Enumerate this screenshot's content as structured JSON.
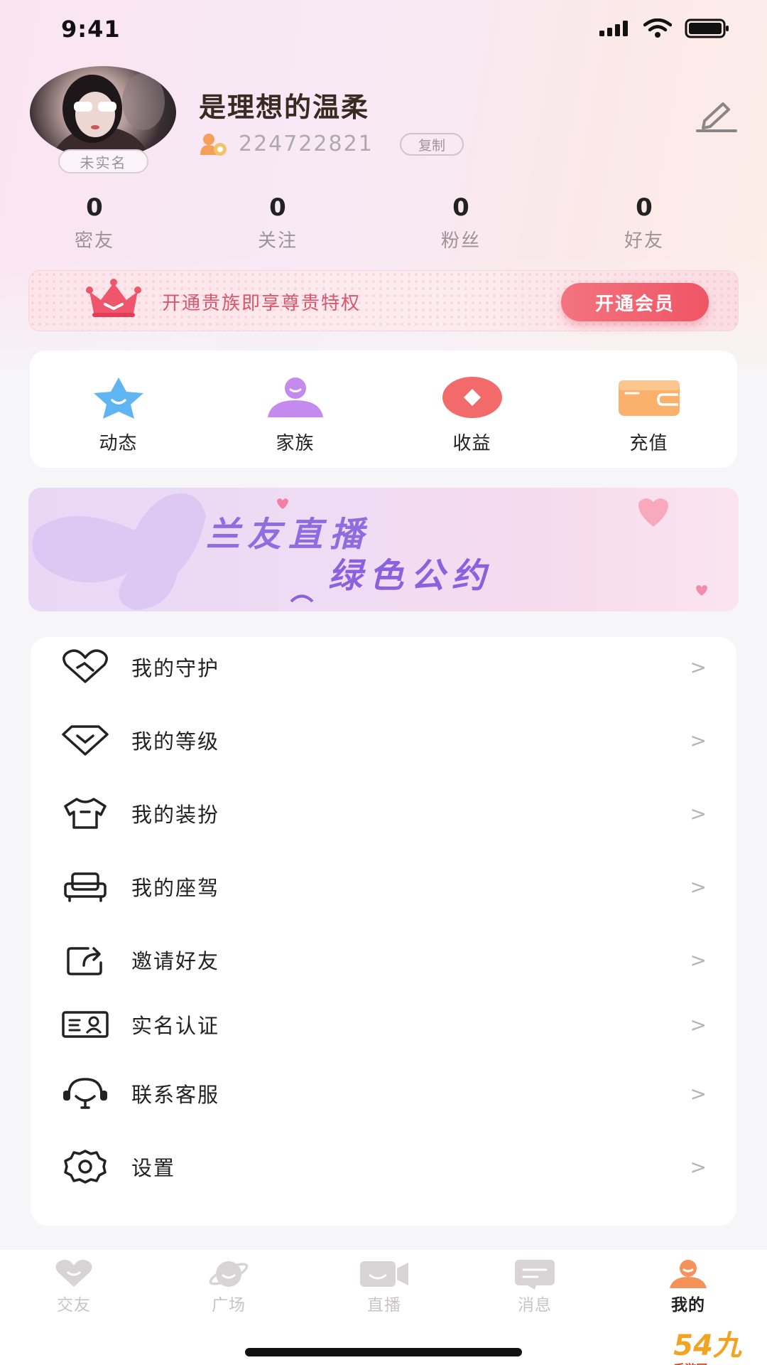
{
  "status_bar": {
    "time": "9:41"
  },
  "profile": {
    "nickname": "是理想的温柔",
    "uid": "224722821",
    "copy_label": "复制",
    "verify_badge": "未实名"
  },
  "stats": [
    {
      "value": "0",
      "label": "密友"
    },
    {
      "value": "0",
      "label": "关注"
    },
    {
      "value": "0",
      "label": "粉丝"
    },
    {
      "value": "0",
      "label": "好友"
    }
  ],
  "vip_banner": {
    "text": "开通贵族即享尊贵特权",
    "button_label": "开通会员",
    "accent": "#ef5564"
  },
  "quick_actions": [
    {
      "label": "动态",
      "icon": "star-icon"
    },
    {
      "label": "家族",
      "icon": "family-icon"
    },
    {
      "label": "收益",
      "icon": "earnings-icon"
    },
    {
      "label": "充值",
      "icon": "wallet-icon"
    }
  ],
  "promo_banner": {
    "line1": "兰友直播",
    "line2": "绿色公约"
  },
  "menu": [
    {
      "label": "我的守护",
      "icon": "heart-handshake-icon"
    },
    {
      "label": "我的等级",
      "icon": "diamond-icon"
    },
    {
      "label": "我的装扮",
      "icon": "tshirt-icon"
    },
    {
      "label": "我的座驾",
      "icon": "car-seat-icon"
    },
    {
      "label": "邀请好友",
      "icon": "share-icon"
    },
    {
      "label": "实名认证",
      "icon": "id-card-icon"
    },
    {
      "label": "联系客服",
      "icon": "headset-icon"
    },
    {
      "label": "设置",
      "icon": "gear-icon"
    }
  ],
  "menu_arrow": ">",
  "tabs": [
    {
      "label": "交友",
      "icon": "heart-tab-icon",
      "active": false
    },
    {
      "label": "广场",
      "icon": "planet-tab-icon",
      "active": false
    },
    {
      "label": "直播",
      "icon": "camera-tab-icon",
      "active": false
    },
    {
      "label": "消息",
      "icon": "message-tab-icon",
      "active": false
    },
    {
      "label": "我的",
      "icon": "profile-tab-icon",
      "active": true
    }
  ],
  "watermark": {
    "text": "54九",
    "sub": "手游网 .com.cn"
  }
}
